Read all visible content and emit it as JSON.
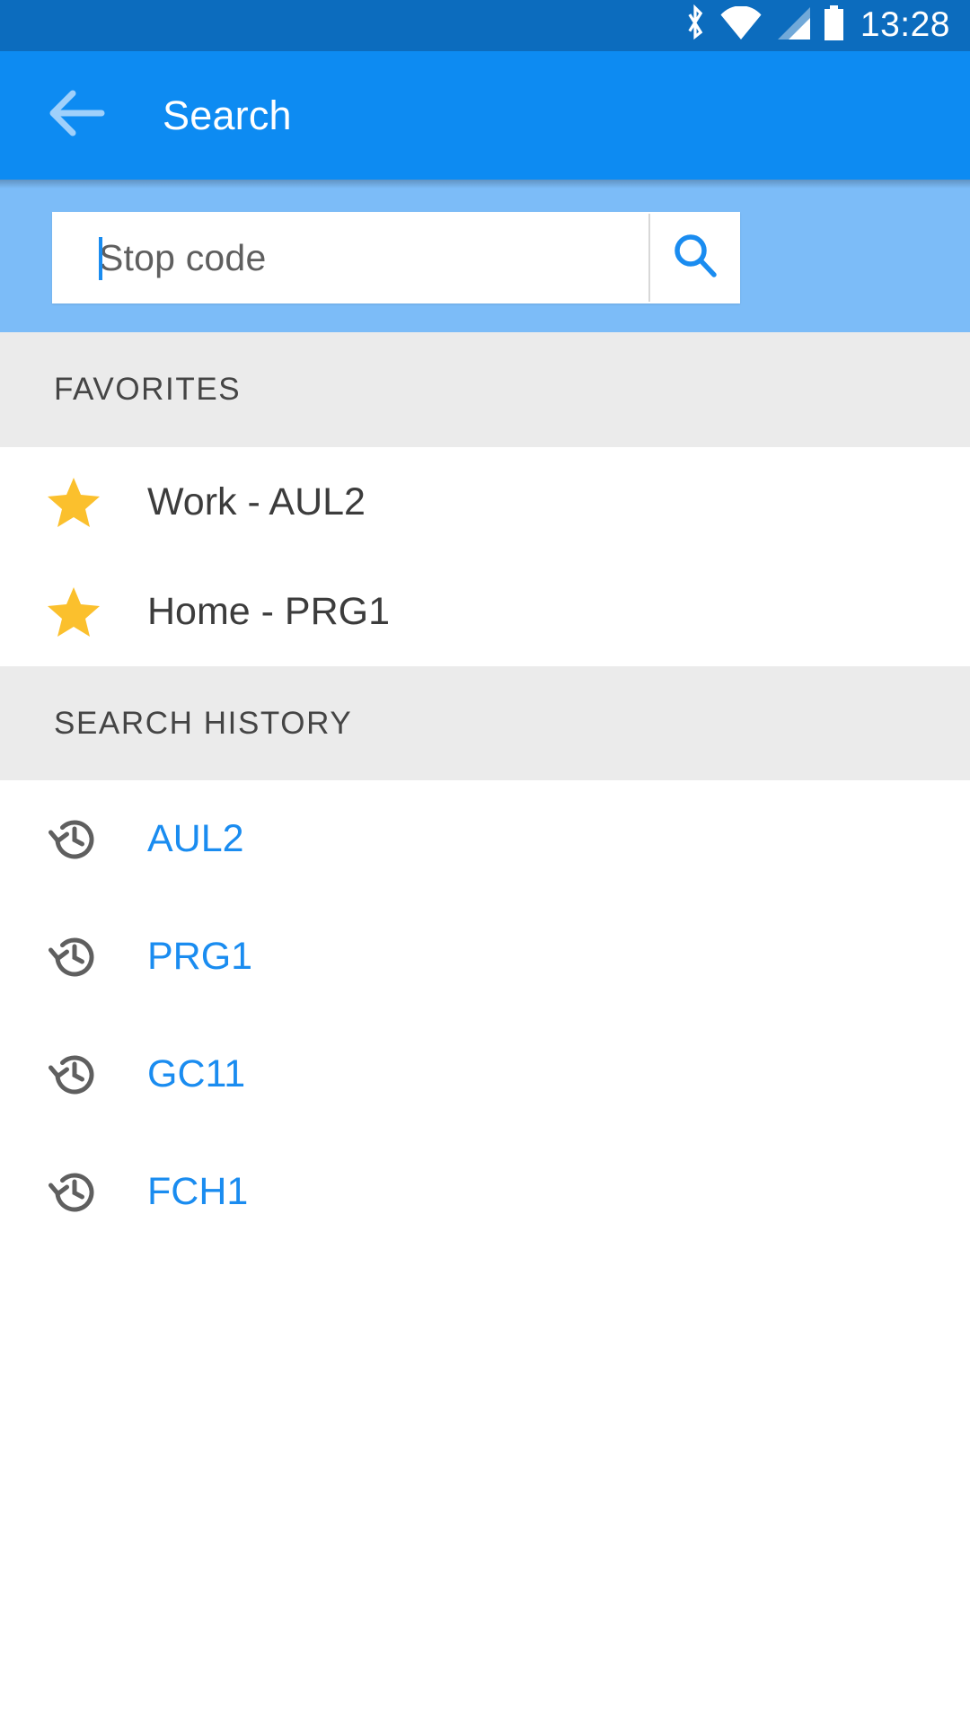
{
  "status_bar": {
    "time": "13:28",
    "icons": [
      "bluetooth-icon",
      "wifi-icon",
      "cellular-signal-icon",
      "battery-icon"
    ]
  },
  "app_bar": {
    "back_icon": "back-arrow-icon",
    "title": "Search",
    "background_color": "#0D8BF2"
  },
  "search": {
    "placeholder": "Stop code",
    "value": "",
    "submit_icon": "search-icon",
    "accent_color": "#1A8CF0"
  },
  "sections": [
    {
      "id": "favorites",
      "header": "FAVORITES",
      "items": [
        {
          "icon": "star-icon",
          "label": "Work - AUL2"
        },
        {
          "icon": "star-icon",
          "label": "Home - PRG1"
        }
      ]
    },
    {
      "id": "search_history",
      "header": "SEARCH HISTORY",
      "items": [
        {
          "icon": "history-icon",
          "label": "AUL2"
        },
        {
          "icon": "history-icon",
          "label": "PRG1"
        },
        {
          "icon": "history-icon",
          "label": "GC11"
        },
        {
          "icon": "history-icon",
          "label": "FCH1"
        }
      ]
    }
  ],
  "colors": {
    "status_bar": "#0C6CBE",
    "primary": "#0D8BF2",
    "search_bg": "#7CBCF8",
    "section_bg": "#EBEBEB",
    "star": "#FBC02D",
    "link": "#1A8CF0"
  }
}
